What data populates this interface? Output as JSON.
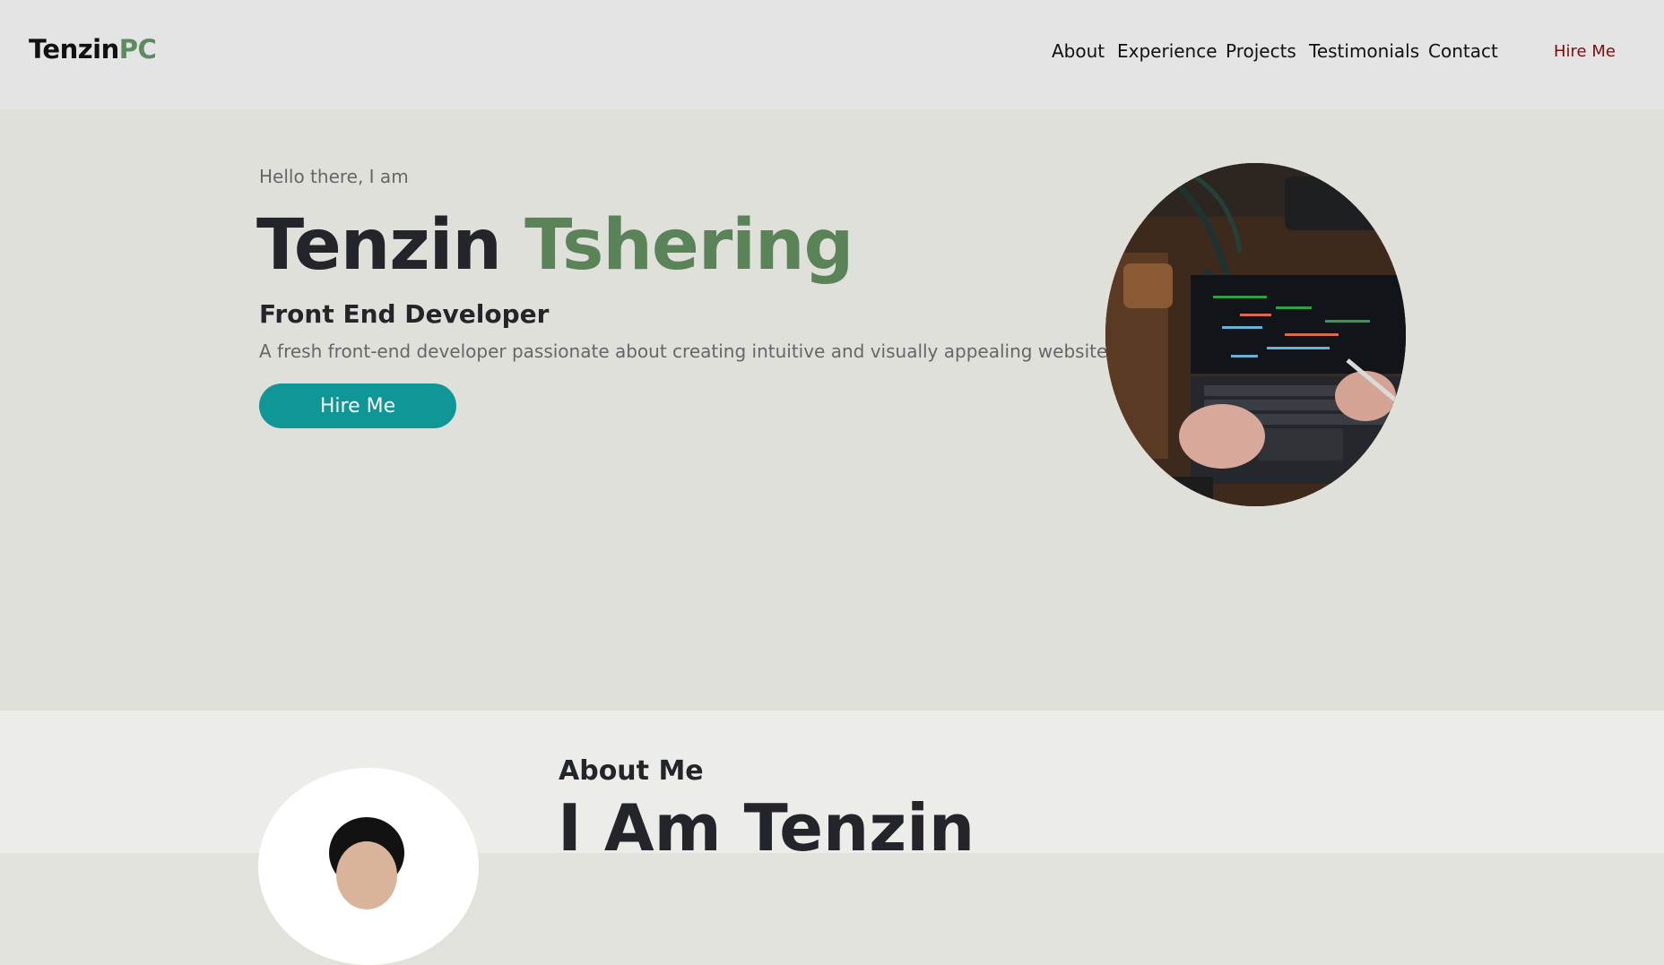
{
  "nav": {
    "logo_main": "Tenzin",
    "logo_accent": "PC",
    "links": [
      "About",
      "Experience",
      "Projects",
      "Testimonials",
      "Contact"
    ],
    "hire_label": "Hire Me"
  },
  "hero": {
    "greeting": "Hello there, I am",
    "name_first": "Tenzin",
    "name_last": "Tshering",
    "role": "Front End Developer",
    "tagline": "A fresh front-end developer passionate about creating intuitive and visually appealing websites.",
    "cta_label": "Hire Me"
  },
  "about": {
    "subtitle": "About Me",
    "title": "I Am Tenzin"
  },
  "colors": {
    "accent_green": "#5a8358",
    "button_teal": "#0f9797",
    "hire_link_red": "#7a0c0c"
  }
}
